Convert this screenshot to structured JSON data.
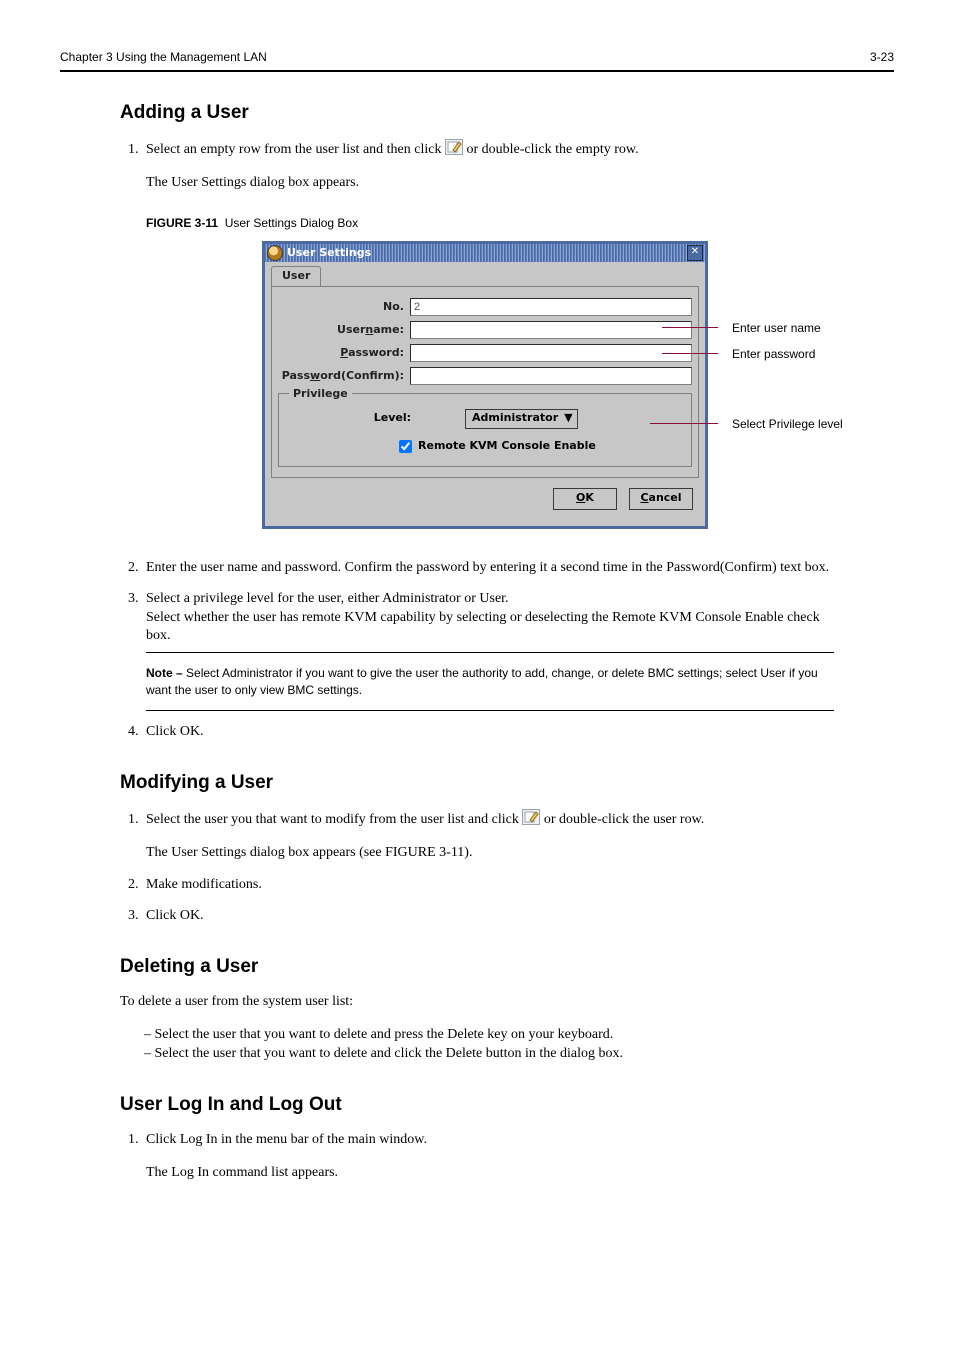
{
  "header": {
    "chapter": "Chapter 3 Using the Management LAN",
    "page": "3-23"
  },
  "section1": {
    "title": "Adding a User",
    "step1_a": "Select an empty row from the user list and then click",
    "step1_b": " or double-click the empty row.",
    "step1_c": "The User Settings dialog box appears.",
    "fig_caption_prefix": "FIGURE 3-11",
    "fig_caption": "User Settings Dialog Box",
    "callouts": {
      "username": "Enter user name",
      "password": "Enter password",
      "level": "Select Privilege level"
    }
  },
  "dialog": {
    "title": "User Settings",
    "tab": "User",
    "no_label": "No.",
    "no_value": "2",
    "username_label_pre": "User",
    "username_label_ul": "n",
    "username_label_post": "ame:",
    "password_label_ul": "P",
    "password_label_post": "assword:",
    "confirm_label_pre": "Pass",
    "confirm_label_ul": "w",
    "confirm_label_post": "ord(Confirm):",
    "group": "Privilege",
    "level_label_ul": "L",
    "level_label_post": "evel:",
    "level_value": "Administrator",
    "remote_ul": "R",
    "remote_post": "emote KVM Console Enable",
    "ok_ul": "O",
    "ok_post": "K",
    "cancel_ul": "C",
    "cancel_post": "ancel"
  },
  "step2": "Enter the user name and password. Confirm the password by entering it a second time in the Password(Confirm) text box.",
  "step3a": "Select a privilege level for the user, either Administrator or User.",
  "step3b": "Select whether the user has remote KVM capability by selecting or deselecting the Remote KVM Console Enable check box.",
  "step3_note": "Select Administrator if you want to give the user the authority to add, change, or delete BMC settings; select User if you want the user to only view BMC settings.",
  "step4": "Click OK.",
  "divider_above": "",
  "section2": {
    "title": "Modifying a User",
    "step1_a": "Select the user you that want to modify from the user list and click",
    "step1_b": " or double-click the user row.",
    "step1_c": "The User Settings dialog box appears (see FIGURE 3-11).",
    "step2": "Make modifications.",
    "step3": "Click OK."
  },
  "section3": {
    "title": "Deleting a User",
    "lead": "To delete a user from the system user list:",
    "bullets": [
      "Select the user that you want to delete and press the Delete key on your keyboard.",
      "Select the user that you want to delete and click the Delete button in the dialog box."
    ]
  },
  "section4": {
    "title": "User Log In and Log Out",
    "step1": "Click Log In in the menu bar of the main window.",
    "step1_after": "The Log In command list appears."
  }
}
